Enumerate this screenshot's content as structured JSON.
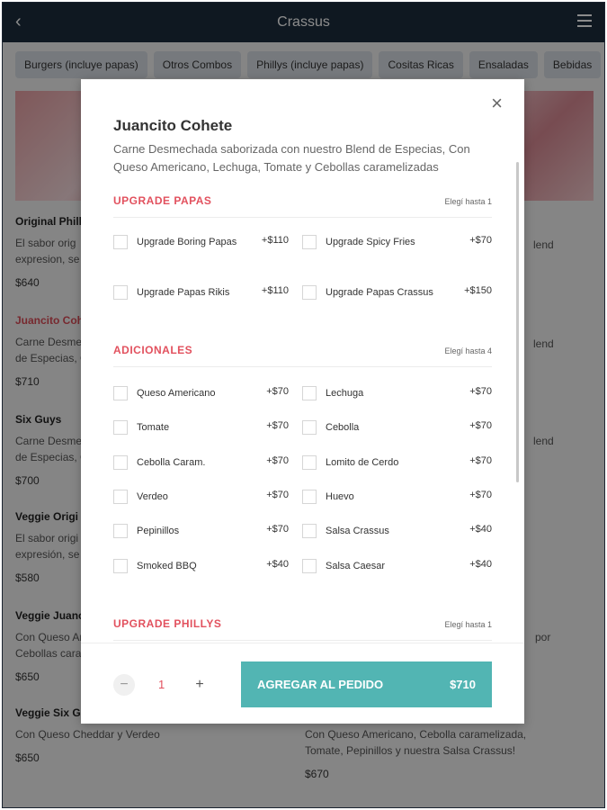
{
  "header": {
    "title": "Crassus"
  },
  "categories": [
    "Burgers (incluye papas)",
    "Otros Combos",
    "Phillys (incluye papas)",
    "Cositas Ricas",
    "Ensaladas",
    "Bebidas"
  ],
  "menu_left": [
    {
      "name": "Original Phill",
      "desc": "El sabor orig\nexpresion, se",
      "price": "$640"
    },
    {
      "name": "Juancito Cohe",
      "desc": "Carne Desme\nde Especias, C",
      "price": "$710"
    },
    {
      "name": "Six Guys",
      "desc": "Carne Desme\nde Especias, C",
      "price": "$700"
    },
    {
      "name": "Veggie Origi",
      "desc": "El sabor origi\nexpresión, se",
      "price": "$580"
    },
    {
      "name": "Veggie Juanc",
      "desc": "Con Queso Ar\nCebollas cara",
      "price": "$650"
    },
    {
      "name": "Veggie Six Gu",
      "desc": "Con Queso Cheddar y Verdeo",
      "price": "$650"
    }
  ],
  "menu_right": [
    {
      "desc": "lend"
    },
    {
      "desc": "lend"
    },
    {
      "desc": "lend"
    },
    {
      "desc": "por"
    },
    {
      "desc": "Con Queso Americano, Cebolla caramelizada,\nTomate, Pepinillos y nuestra Salsa Crassus!",
      "price": "$670"
    }
  ],
  "modal": {
    "title": "Juancito Cohete",
    "description": "Carne Desmechada saborizada con nuestro Blend de Especias, Con Queso Americano, Lechuga, Tomate y Cebollas caramelizadas",
    "close_label": "×",
    "sections": [
      {
        "title": "UPGRADE PAPAS",
        "limit": "Elegí hasta 1",
        "options": [
          {
            "label": "Upgrade Boring Papas",
            "price": "+$110"
          },
          {
            "label": "Upgrade Spicy Fries",
            "price": "+$70"
          },
          {
            "label": "Upgrade Papas Rikis",
            "price": "+$110"
          },
          {
            "label": "Upgrade Papas Crassus",
            "price": "+$150"
          }
        ]
      },
      {
        "title": "ADICIONALES",
        "limit": "Elegí hasta 4",
        "options": [
          {
            "label": "Queso Americano",
            "price": "+$70"
          },
          {
            "label": "Lechuga",
            "price": "+$70"
          },
          {
            "label": "Tomate",
            "price": "+$70"
          },
          {
            "label": "Cebolla",
            "price": "+$70"
          },
          {
            "label": "Cebolla Caram.",
            "price": "+$70"
          },
          {
            "label": "Lomito de Cerdo",
            "price": "+$70"
          },
          {
            "label": "Verdeo",
            "price": "+$70"
          },
          {
            "label": "Huevo",
            "price": "+$70"
          },
          {
            "label": "Pepinillos",
            "price": "+$70"
          },
          {
            "label": "Salsa Crassus",
            "price": "+$40"
          },
          {
            "label": "Smoked BBQ",
            "price": "+$40"
          },
          {
            "label": "Salsa Caesar",
            "price": "+$40"
          }
        ]
      },
      {
        "title": "UPGRADE PHILLYS",
        "limit": "Elegí hasta 1",
        "options": []
      }
    ],
    "footer": {
      "minus": "−",
      "quantity": "1",
      "plus": "+",
      "add_label": "AGREGAR AL PEDIDO",
      "add_price": "$710"
    }
  },
  "colors": {
    "accent": "#e2515e",
    "button": "#52b5b3",
    "topbar": "#1d2c3c"
  }
}
